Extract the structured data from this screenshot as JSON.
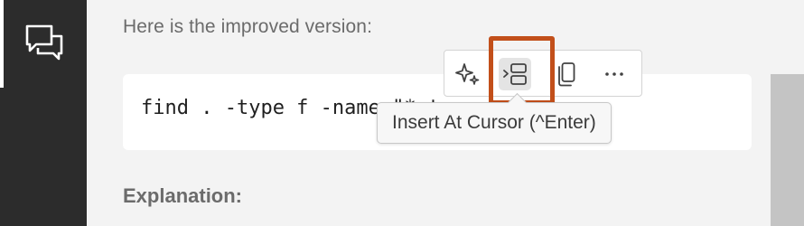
{
  "activity_bar": {
    "active_item": "chat-icon"
  },
  "chat": {
    "intro_text": "Here is the improved version:",
    "code": "find . -type f -name \"*.t",
    "explanation_heading": "Explanation:"
  },
  "code_toolbar": {
    "buttons": [
      {
        "name": "sparkle-icon"
      },
      {
        "name": "insert-at-cursor-icon"
      },
      {
        "name": "copy-icon"
      },
      {
        "name": "more-icon"
      }
    ]
  },
  "tooltip": {
    "text": "Insert At Cursor (^Enter)"
  },
  "colors": {
    "highlight": "#c24f1a",
    "activity_bar": "#2c2c2c",
    "panel_background": "#f3f3f3"
  }
}
